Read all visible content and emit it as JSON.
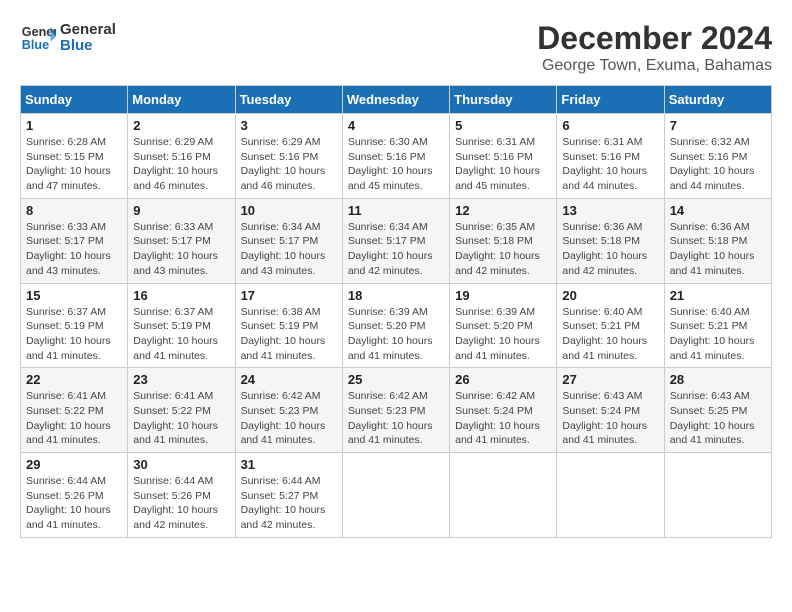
{
  "header": {
    "logo_line1": "General",
    "logo_line2": "Blue",
    "month_title": "December 2024",
    "subtitle": "George Town, Exuma, Bahamas"
  },
  "weekdays": [
    "Sunday",
    "Monday",
    "Tuesday",
    "Wednesday",
    "Thursday",
    "Friday",
    "Saturday"
  ],
  "weeks": [
    [
      {
        "day": "1",
        "info": "Sunrise: 6:28 AM\nSunset: 5:15 PM\nDaylight: 10 hours and 47 minutes."
      },
      {
        "day": "2",
        "info": "Sunrise: 6:29 AM\nSunset: 5:16 PM\nDaylight: 10 hours and 46 minutes."
      },
      {
        "day": "3",
        "info": "Sunrise: 6:29 AM\nSunset: 5:16 PM\nDaylight: 10 hours and 46 minutes."
      },
      {
        "day": "4",
        "info": "Sunrise: 6:30 AM\nSunset: 5:16 PM\nDaylight: 10 hours and 45 minutes."
      },
      {
        "day": "5",
        "info": "Sunrise: 6:31 AM\nSunset: 5:16 PM\nDaylight: 10 hours and 45 minutes."
      },
      {
        "day": "6",
        "info": "Sunrise: 6:31 AM\nSunset: 5:16 PM\nDaylight: 10 hours and 44 minutes."
      },
      {
        "day": "7",
        "info": "Sunrise: 6:32 AM\nSunset: 5:16 PM\nDaylight: 10 hours and 44 minutes."
      }
    ],
    [
      {
        "day": "8",
        "info": "Sunrise: 6:33 AM\nSunset: 5:17 PM\nDaylight: 10 hours and 43 minutes."
      },
      {
        "day": "9",
        "info": "Sunrise: 6:33 AM\nSunset: 5:17 PM\nDaylight: 10 hours and 43 minutes."
      },
      {
        "day": "10",
        "info": "Sunrise: 6:34 AM\nSunset: 5:17 PM\nDaylight: 10 hours and 43 minutes."
      },
      {
        "day": "11",
        "info": "Sunrise: 6:34 AM\nSunset: 5:17 PM\nDaylight: 10 hours and 42 minutes."
      },
      {
        "day": "12",
        "info": "Sunrise: 6:35 AM\nSunset: 5:18 PM\nDaylight: 10 hours and 42 minutes."
      },
      {
        "day": "13",
        "info": "Sunrise: 6:36 AM\nSunset: 5:18 PM\nDaylight: 10 hours and 42 minutes."
      },
      {
        "day": "14",
        "info": "Sunrise: 6:36 AM\nSunset: 5:18 PM\nDaylight: 10 hours and 41 minutes."
      }
    ],
    [
      {
        "day": "15",
        "info": "Sunrise: 6:37 AM\nSunset: 5:19 PM\nDaylight: 10 hours and 41 minutes."
      },
      {
        "day": "16",
        "info": "Sunrise: 6:37 AM\nSunset: 5:19 PM\nDaylight: 10 hours and 41 minutes."
      },
      {
        "day": "17",
        "info": "Sunrise: 6:38 AM\nSunset: 5:19 PM\nDaylight: 10 hours and 41 minutes."
      },
      {
        "day": "18",
        "info": "Sunrise: 6:39 AM\nSunset: 5:20 PM\nDaylight: 10 hours and 41 minutes."
      },
      {
        "day": "19",
        "info": "Sunrise: 6:39 AM\nSunset: 5:20 PM\nDaylight: 10 hours and 41 minutes."
      },
      {
        "day": "20",
        "info": "Sunrise: 6:40 AM\nSunset: 5:21 PM\nDaylight: 10 hours and 41 minutes."
      },
      {
        "day": "21",
        "info": "Sunrise: 6:40 AM\nSunset: 5:21 PM\nDaylight: 10 hours and 41 minutes."
      }
    ],
    [
      {
        "day": "22",
        "info": "Sunrise: 6:41 AM\nSunset: 5:22 PM\nDaylight: 10 hours and 41 minutes."
      },
      {
        "day": "23",
        "info": "Sunrise: 6:41 AM\nSunset: 5:22 PM\nDaylight: 10 hours and 41 minutes."
      },
      {
        "day": "24",
        "info": "Sunrise: 6:42 AM\nSunset: 5:23 PM\nDaylight: 10 hours and 41 minutes."
      },
      {
        "day": "25",
        "info": "Sunrise: 6:42 AM\nSunset: 5:23 PM\nDaylight: 10 hours and 41 minutes."
      },
      {
        "day": "26",
        "info": "Sunrise: 6:42 AM\nSunset: 5:24 PM\nDaylight: 10 hours and 41 minutes."
      },
      {
        "day": "27",
        "info": "Sunrise: 6:43 AM\nSunset: 5:24 PM\nDaylight: 10 hours and 41 minutes."
      },
      {
        "day": "28",
        "info": "Sunrise: 6:43 AM\nSunset: 5:25 PM\nDaylight: 10 hours and 41 minutes."
      }
    ],
    [
      {
        "day": "29",
        "info": "Sunrise: 6:44 AM\nSunset: 5:26 PM\nDaylight: 10 hours and 41 minutes."
      },
      {
        "day": "30",
        "info": "Sunrise: 6:44 AM\nSunset: 5:26 PM\nDaylight: 10 hours and 42 minutes."
      },
      {
        "day": "31",
        "info": "Sunrise: 6:44 AM\nSunset: 5:27 PM\nDaylight: 10 hours and 42 minutes."
      },
      null,
      null,
      null,
      null
    ]
  ]
}
